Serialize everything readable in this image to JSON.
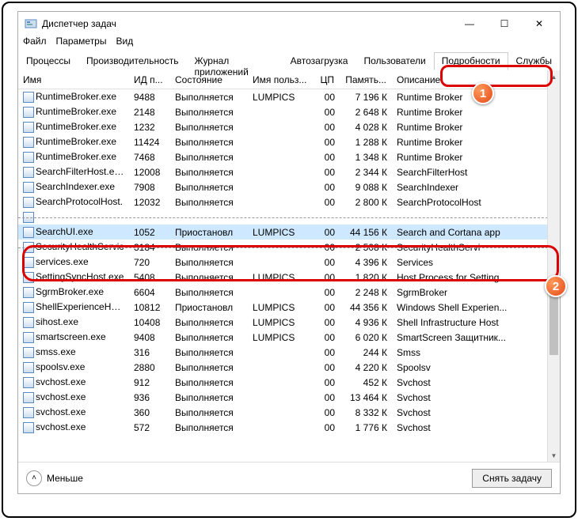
{
  "window": {
    "title": "Диспетчер задач",
    "minimize": "—",
    "maximize": "☐",
    "close": "✕"
  },
  "menu": {
    "file": "Файл",
    "options": "Параметры",
    "view": "Вид"
  },
  "tabs": {
    "processes": "Процессы",
    "performance": "Производительность",
    "apphistory": "Журнал приложений",
    "startup": "Автозагрузка",
    "users": "Пользователи",
    "details": "Подробности",
    "services": "Службы"
  },
  "columns": {
    "name": "Имя",
    "pid": "ИД п...",
    "state": "Состояние",
    "user": "Имя польз...",
    "cpu": "ЦП",
    "mem": "Память...",
    "desc": "Описание"
  },
  "rows": [
    {
      "name": "RuntimeBroker.exe",
      "pid": "9488",
      "state": "Выполняется",
      "user": "LUMPICS",
      "cpu": "00",
      "mem": "7 196 К",
      "desc": "Runtime Broker"
    },
    {
      "name": "RuntimeBroker.exe",
      "pid": "2148",
      "state": "Выполняется",
      "user": "",
      "cpu": "00",
      "mem": "2 648 К",
      "desc": "Runtime Broker"
    },
    {
      "name": "RuntimeBroker.exe",
      "pid": "1232",
      "state": "Выполняется",
      "user": "",
      "cpu": "00",
      "mem": "4 028 К",
      "desc": "Runtime Broker"
    },
    {
      "name": "RuntimeBroker.exe",
      "pid": "11424",
      "state": "Выполняется",
      "user": "",
      "cpu": "00",
      "mem": "1 288 К",
      "desc": "Runtime Broker"
    },
    {
      "name": "RuntimeBroker.exe",
      "pid": "7468",
      "state": "Выполняется",
      "user": "",
      "cpu": "00",
      "mem": "1 348 К",
      "desc": "Runtime Broker"
    },
    {
      "name": "SearchFilterHost.exe",
      "pid": "12008",
      "state": "Выполняется",
      "user": "",
      "cpu": "00",
      "mem": "2 344 К",
      "desc": "SearchFilterHost"
    },
    {
      "name": "SearchIndexer.exe",
      "pid": "7908",
      "state": "Выполняется",
      "user": "",
      "cpu": "00",
      "mem": "9 088 К",
      "desc": "SearchIndexer"
    },
    {
      "name": "SearchProtocolHost.",
      "pid": "12032",
      "state": "Выполняется",
      "user": "",
      "cpu": "00",
      "mem": "2 800 К",
      "desc": "SearchProtocolHost"
    },
    {
      "name": "",
      "pid": "",
      "state": "",
      "user": "",
      "cpu": "",
      "mem": "",
      "desc": "",
      "cut": true
    },
    {
      "name": "SearchUI.exe",
      "pid": "1052",
      "state": "Приостановл",
      "user": "LUMPICS",
      "cpu": "00",
      "mem": "44 156 К",
      "desc": "Search and Cortana app",
      "selected": true
    },
    {
      "name": "SecurityHealthServic",
      "pid": "3184",
      "state": "Выполняется",
      "user": "",
      "cpu": "00",
      "mem": "2 508 К",
      "desc": "SecurityHealthServi",
      "cut": true
    },
    {
      "name": "services.exe",
      "pid": "720",
      "state": "Выполняется",
      "user": "",
      "cpu": "00",
      "mem": "4 396 К",
      "desc": "Services"
    },
    {
      "name": "SettingSyncHost.exe",
      "pid": "5408",
      "state": "Выполняется",
      "user": "LUMPICS",
      "cpu": "00",
      "mem": "1 820 К",
      "desc": "Host Process for Setting..."
    },
    {
      "name": "SgrmBroker.exe",
      "pid": "6604",
      "state": "Выполняется",
      "user": "",
      "cpu": "00",
      "mem": "2 248 К",
      "desc": "SgrmBroker"
    },
    {
      "name": "ShellExperienceHost.",
      "pid": "10812",
      "state": "Приостановл",
      "user": "LUMPICS",
      "cpu": "00",
      "mem": "44 356 К",
      "desc": "Windows Shell Experien..."
    },
    {
      "name": "sihost.exe",
      "pid": "10408",
      "state": "Выполняется",
      "user": "LUMPICS",
      "cpu": "00",
      "mem": "4 936 К",
      "desc": "Shell Infrastructure Host"
    },
    {
      "name": "smartscreen.exe",
      "pid": "9408",
      "state": "Выполняется",
      "user": "LUMPICS",
      "cpu": "00",
      "mem": "6 020 К",
      "desc": "SmartScreen Защитник..."
    },
    {
      "name": "smss.exe",
      "pid": "316",
      "state": "Выполняется",
      "user": "",
      "cpu": "00",
      "mem": "244 К",
      "desc": "Smss"
    },
    {
      "name": "spoolsv.exe",
      "pid": "2880",
      "state": "Выполняется",
      "user": "",
      "cpu": "00",
      "mem": "4 220 К",
      "desc": "Spoolsv"
    },
    {
      "name": "svchost.exe",
      "pid": "912",
      "state": "Выполняется",
      "user": "",
      "cpu": "00",
      "mem": "452 К",
      "desc": "Svchost"
    },
    {
      "name": "svchost.exe",
      "pid": "936",
      "state": "Выполняется",
      "user": "",
      "cpu": "00",
      "mem": "13 464 К",
      "desc": "Svchost"
    },
    {
      "name": "svchost.exe",
      "pid": "360",
      "state": "Выполняется",
      "user": "",
      "cpu": "00",
      "mem": "8 332 К",
      "desc": "Svchost"
    },
    {
      "name": "svchost.exe",
      "pid": "572",
      "state": "Выполняется",
      "user": "",
      "cpu": "00",
      "mem": "1 776 К",
      "desc": "Svchost"
    }
  ],
  "footer": {
    "less": "Меньше",
    "endtask": "Снять задачу"
  },
  "badges": {
    "one": "1",
    "two": "2"
  }
}
